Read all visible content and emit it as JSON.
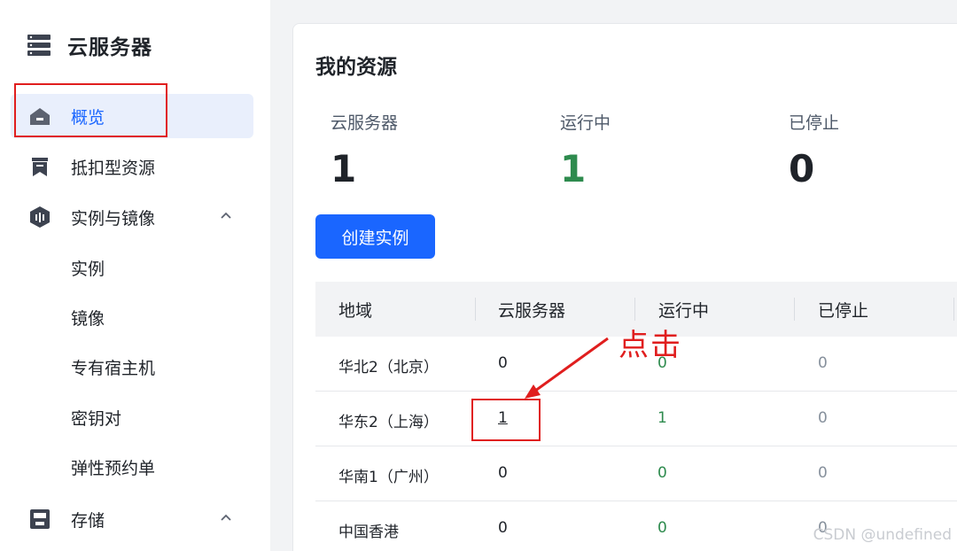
{
  "sidebar": {
    "title": "云服务器",
    "items": [
      {
        "label": "概览",
        "icon": "home-icon"
      },
      {
        "label": "抵扣型资源",
        "icon": "bookmark-icon"
      },
      {
        "label": "实例与镜像",
        "icon": "instance-icon"
      },
      {
        "label": "存储",
        "icon": "storage-icon"
      }
    ],
    "sub_items": [
      "实例",
      "镜像",
      "专有宿主机",
      "密钥对",
      "弹性预约单"
    ]
  },
  "main": {
    "title": "我的资源",
    "stats": [
      {
        "label": "云服务器",
        "value": "1"
      },
      {
        "label": "运行中",
        "value": "1"
      },
      {
        "label": "已停止",
        "value": "0"
      }
    ],
    "create_button": "创建实例",
    "table": {
      "headers": [
        "地域",
        "云服务器",
        "运行中",
        "已停止"
      ],
      "rows": [
        [
          "华北2（北京）",
          "0",
          "0",
          "0"
        ],
        [
          "华东2（上海）",
          "1",
          "1",
          "0"
        ],
        [
          "华南1（广州）",
          "0",
          "0",
          "0"
        ],
        [
          "中国香港",
          "0",
          "0",
          "0"
        ]
      ]
    }
  },
  "annotation": {
    "text": "点击"
  },
  "watermark": "CSDN @undefined",
  "colors": {
    "accent": "#1a66ff",
    "running": "#2e8b4e",
    "annotation": "#e01e1e"
  }
}
